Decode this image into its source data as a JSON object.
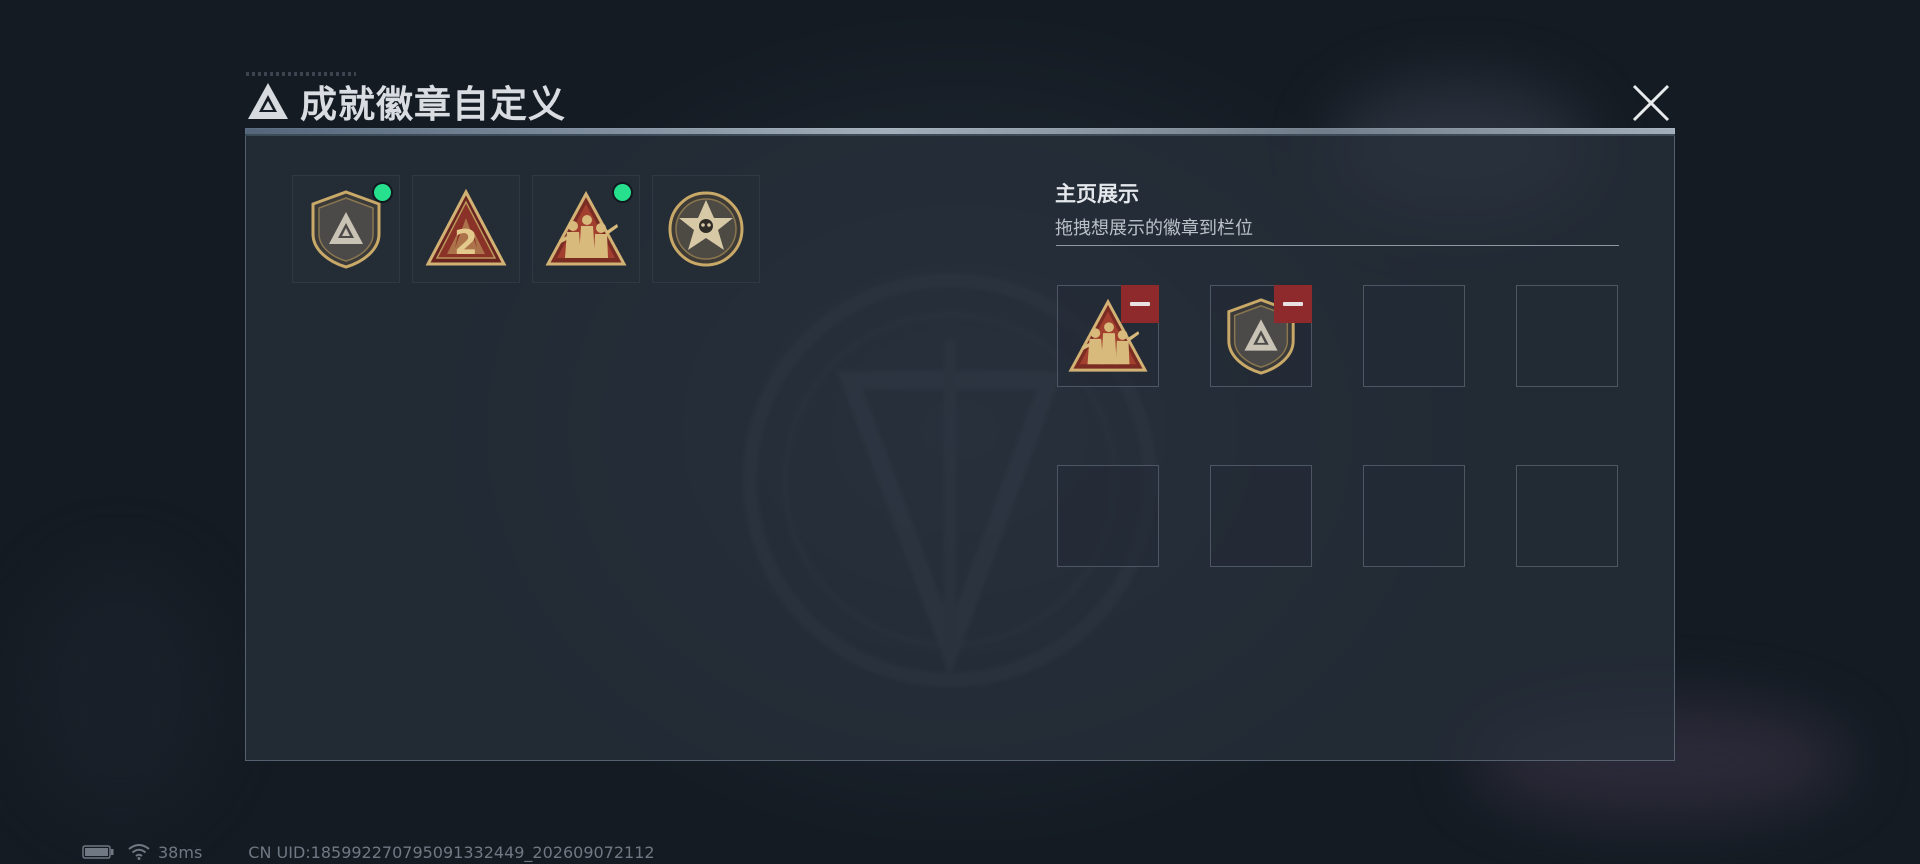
{
  "panel": {
    "title": "成就徽章自定义"
  },
  "inventory": {
    "badges": [
      {
        "icon": "shield-triangle-badge-icon",
        "is_new": true
      },
      {
        "icon": "flame-two-badge-icon",
        "is_new": false
      },
      {
        "icon": "soldiers-triangle-badge-icon",
        "is_new": true
      },
      {
        "icon": "skull-star-badge-icon",
        "is_new": false
      }
    ]
  },
  "display": {
    "title": "主页展示",
    "subtitle": "拖拽想展示的徽章到栏位",
    "slots": [
      {
        "badge": "soldiers-triangle-badge-icon"
      },
      {
        "badge": "shield-triangle-badge-icon"
      },
      {
        "badge": ""
      },
      {
        "badge": ""
      },
      {
        "badge": ""
      },
      {
        "badge": ""
      },
      {
        "badge": ""
      },
      {
        "badge": ""
      }
    ]
  },
  "status": {
    "ping": "38ms",
    "uid": "CN UID:185992270795091332449_202609072112"
  },
  "colors": {
    "new_indicator": "#26e08e",
    "remove_button": "#8e2a2c",
    "badge_gold": "#c9a968",
    "panel_bg": "#28313c"
  }
}
